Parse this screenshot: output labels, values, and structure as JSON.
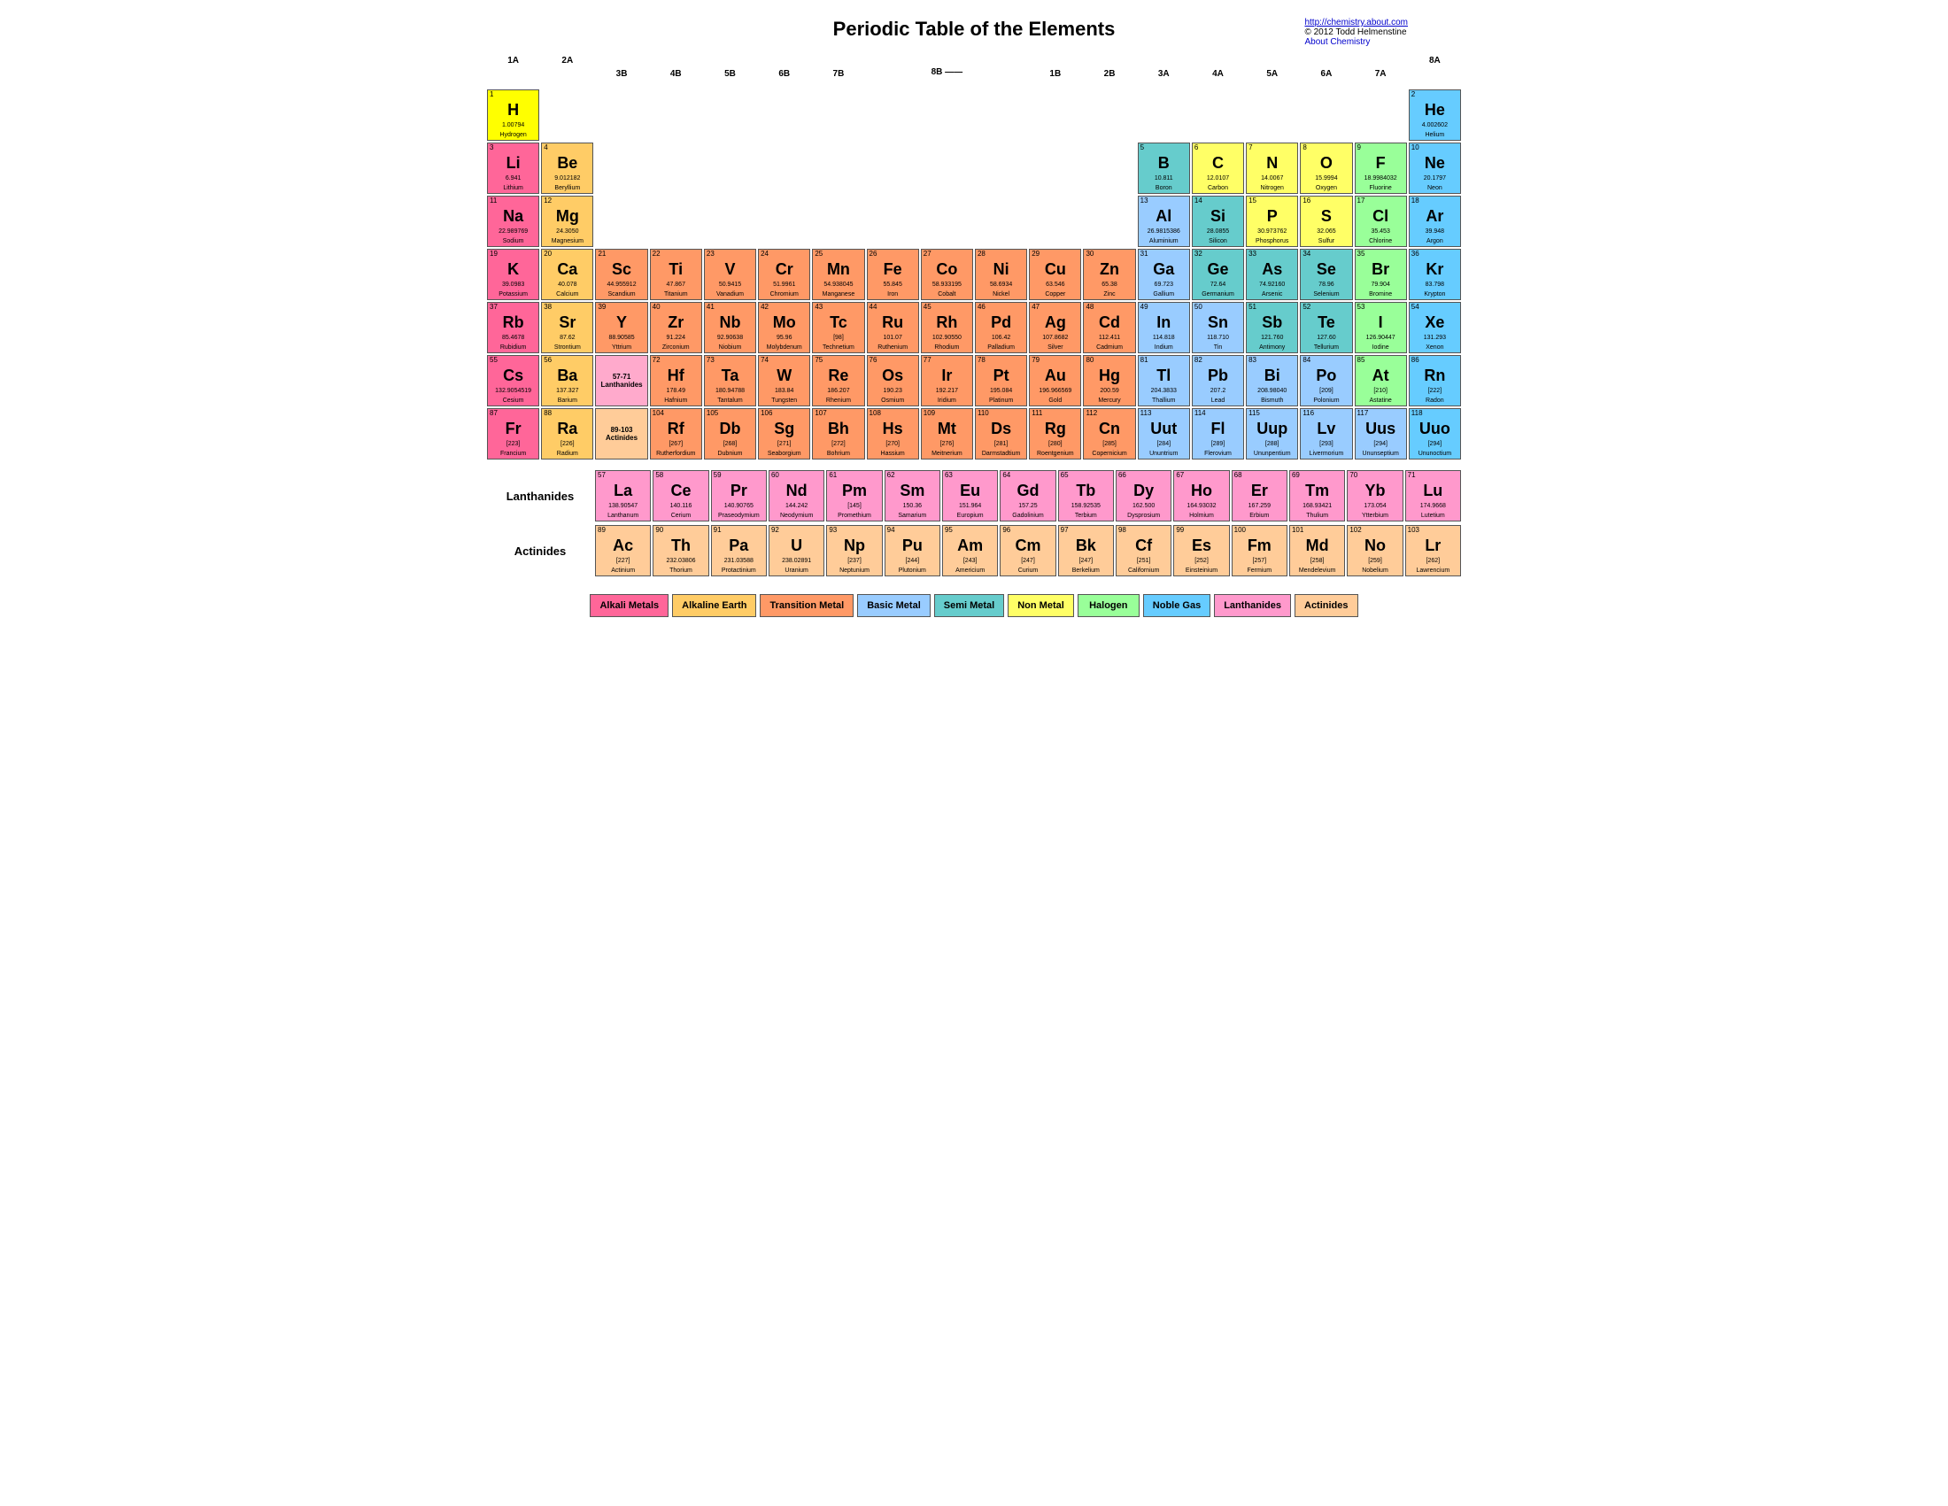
{
  "title": "Periodic Table of the Elements",
  "header_link": "http://chemistry.about.com",
  "copyright": "© 2012 Todd Helmenstine",
  "about": "About Chemistry",
  "group_labels": [
    "1A",
    "2A",
    "3B",
    "4B",
    "5B",
    "6B",
    "7B",
    "8B",
    "8B",
    "8B",
    "1B",
    "2B",
    "3A",
    "4A",
    "5A",
    "6A",
    "7A",
    "8A"
  ],
  "legend": [
    {
      "label": "Alkali Metals",
      "class": "alkali"
    },
    {
      "label": "Alkaline Earth",
      "class": "alkaline"
    },
    {
      "label": "Transition Metal",
      "class": "transition"
    },
    {
      "label": "Basic Metal",
      "class": "basic-metal"
    },
    {
      "label": "Semi Metal",
      "class": "semi-metal"
    },
    {
      "label": "Non Metal",
      "class": "nonmetal"
    },
    {
      "label": "Halogen",
      "class": "halogen"
    },
    {
      "label": "Noble Gas",
      "class": "noble"
    },
    {
      "label": "Lanthanides",
      "class": "lanthanide"
    },
    {
      "label": "Actinides",
      "class": "actinide"
    }
  ]
}
